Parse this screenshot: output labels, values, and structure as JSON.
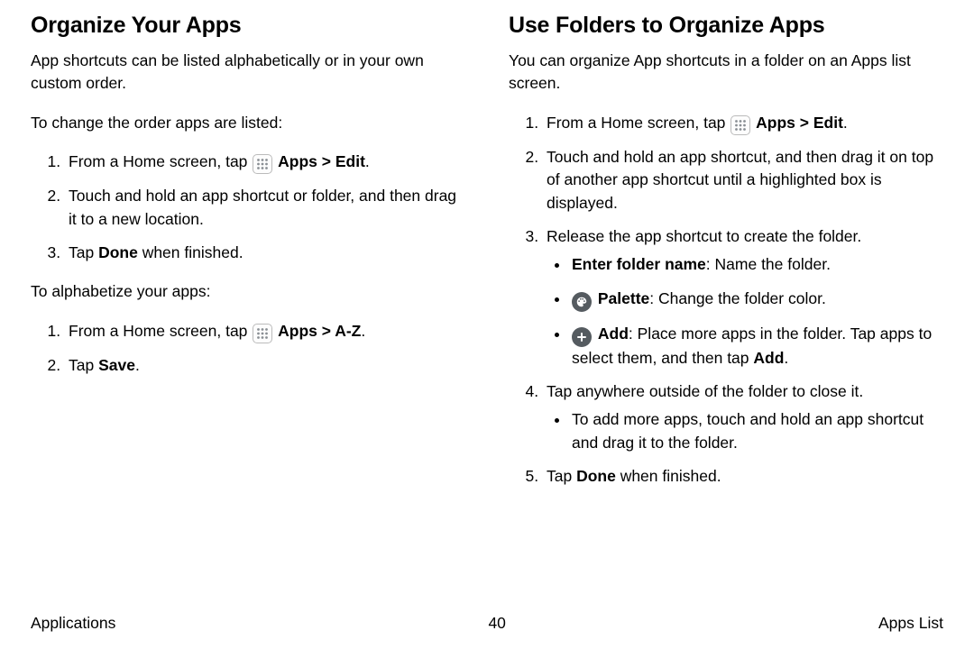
{
  "left": {
    "heading": "Organize Your Apps",
    "intro": "App shortcuts can be listed alphabetically or in your own custom order.",
    "changeOrderLead": "To change the order apps are listed:",
    "step1a": "From a Home screen, tap ",
    "step1b": "Apps > Edit",
    "step1c": ".",
    "step2": "Touch and hold an app shortcut or folder, and then drag it to a new location.",
    "step3a": "Tap ",
    "step3b": "Done",
    "step3c": " when finished.",
    "alphaLead": "To alphabetize your apps:",
    "astep1a": "From a Home screen, tap ",
    "astep1b": "Apps > A-Z",
    "astep1c": ".",
    "astep2a": "Tap ",
    "astep2b": "Save",
    "astep2c": "."
  },
  "right": {
    "heading": "Use Folders to Organize Apps",
    "intro": "You can organize App shortcuts in a folder on an Apps list screen.",
    "step1a": "From a Home screen, tap ",
    "step1b": "Apps > Edit",
    "step1c": ".",
    "step2": "Touch and hold an app shortcut, and then drag it on top of another app shortcut until a highlighted box is displayed.",
    "step3": "Release the app shortcut to create the folder.",
    "b1a": "Enter folder name",
    "b1b": ": Name the folder.",
    "b2a": "Palette",
    "b2b": ": Change the folder color.",
    "b3a": "Add",
    "b3b": ": Place more apps in the folder. Tap apps to select them, and then tap ",
    "b3c": "Add",
    "b3d": ".",
    "step4": "Tap anywhere outside of the folder to close it.",
    "b4": "To add more apps, touch and hold an app shortcut and drag it to the folder.",
    "step5a": "Tap ",
    "step5b": "Done",
    "step5c": " when finished."
  },
  "footer": {
    "left": "Applications",
    "center": "40",
    "right": "Apps List"
  }
}
